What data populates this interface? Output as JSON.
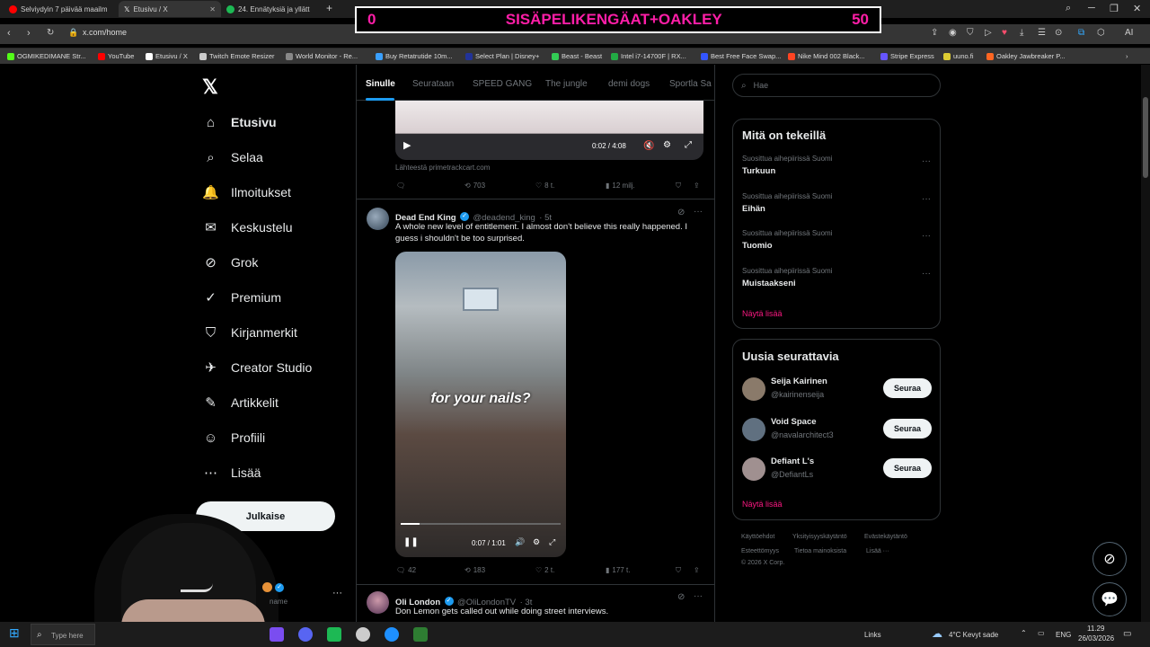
{
  "browser": {
    "tabs": [
      {
        "label": "Selviydyin 7 päivää maailm",
        "color": "#ff0000"
      },
      {
        "label": "Etusivu / X",
        "color": "#ffffff"
      },
      {
        "label": "24. Ennätyksiä ja yllätt",
        "color": "#1db954"
      }
    ],
    "new_tab": "+",
    "url": "x.com/home",
    "bookmarks": [
      {
        "label": "OGMIKEDIMANE Str...",
        "color": "#53fc18"
      },
      {
        "label": "YouTube",
        "color": "#ff0000"
      },
      {
        "label": "Etusivu / X",
        "color": "#ffffff"
      },
      {
        "label": "Twitch Emote Resizer",
        "color": "#cccccc"
      },
      {
        "label": "World Monitor - Re...",
        "color": "#888888"
      },
      {
        "label": "Buy Retatrutide 10m...",
        "color": "#3aa0ff"
      },
      {
        "label": "Select Plan | Disney+",
        "color": "#223399"
      },
      {
        "label": "Beast - Beast",
        "color": "#33cc55"
      },
      {
        "label": "Intel i7-14700F | RX...",
        "color": "#22aa44"
      },
      {
        "label": "Best Free Face Swap...",
        "color": "#3355ff"
      },
      {
        "label": "Nike Mind 002 Black...",
        "color": "#ff4422"
      },
      {
        "label": "Stripe Express",
        "color": "#6655ff"
      },
      {
        "label": "uuno.fi",
        "color": "#ddcc33"
      },
      {
        "label": "Oakley Jawbreaker P...",
        "color": "#ff6622"
      }
    ],
    "ai_label": "AI"
  },
  "overlay": {
    "left": "0",
    "title": "SISÄPELIKENGÄAT+OAKLEY",
    "right": "50"
  },
  "nav": {
    "items": [
      {
        "label": "Etusivu",
        "icon": "home-icon"
      },
      {
        "label": "Selaa",
        "icon": "search-icon"
      },
      {
        "label": "Ilmoitukset",
        "icon": "bell-icon"
      },
      {
        "label": "Keskustelu",
        "icon": "mail-icon"
      },
      {
        "label": "Grok",
        "icon": "grok-icon"
      },
      {
        "label": "Premium",
        "icon": "premium-icon"
      },
      {
        "label": "Kirjanmerkit",
        "icon": "bookmark-icon"
      },
      {
        "label": "Creator Studio",
        "icon": "rocket-icon"
      },
      {
        "label": "Artikkelit",
        "icon": "article-icon"
      },
      {
        "label": "Profiili",
        "icon": "person-icon"
      },
      {
        "label": "Lisää",
        "icon": "more-circle-icon"
      }
    ],
    "post_button": "Julkaise",
    "account_handle_fragment": "name"
  },
  "feed": {
    "tabs": [
      "Sinulle",
      "Seurataan",
      "SPEED GANG",
      "The jungle",
      "demi dogs",
      "Sportla Sa"
    ],
    "tweet1": {
      "video_time": "0:02 / 4:08",
      "source": "Lähteestä primetrackcart.com",
      "retweets": "703",
      "likes": "8 t.",
      "views": "12 milj."
    },
    "tweet2": {
      "name": "Dead End King",
      "handle": "@deadend_king",
      "time": "· 5t",
      "text_line1": "A whole new level of entitlement. I almost don't believe this really happened. I",
      "text_line2": "guess i shouldn't be too surprised.",
      "caption": "for your nails?",
      "video_time": "0:07 / 1:01",
      "replies": "42",
      "retweets": "183",
      "likes": "2 t.",
      "views": "177 t."
    },
    "tweet3": {
      "name": "Oli London",
      "handle": "@OliLondonTV",
      "time": "· 3t",
      "text": "Don Lemon gets called out while doing street interviews."
    }
  },
  "right": {
    "search_placeholder": "Hae",
    "trends_title": "Mitä on tekeillä",
    "trends": [
      {
        "category": "Suosittua aihepiirissä Suomi",
        "name": "Turkuun"
      },
      {
        "category": "Suosittua aihepiirissä Suomi",
        "name": "Eihän"
      },
      {
        "category": "Suosittua aihepiirissä Suomi",
        "name": "Tuomio"
      },
      {
        "category": "Suosittua aihepiirissä Suomi",
        "name": "Muistaakseni"
      }
    ],
    "show_more": "Näytä lisää",
    "follow_title": "Uusia seurattavia",
    "follow": [
      {
        "name": "Seija Kairinen",
        "handle": "@kairinenseija",
        "button": "Seuraa"
      },
      {
        "name": "Void Space",
        "handle": "@navalarchitect3",
        "button": "Seuraa"
      },
      {
        "name": "Defiant L's",
        "handle": "@DefiantLs",
        "button": "Seuraa"
      }
    ],
    "footer": [
      "Käyttöehdot",
      "Yksityisyyskäytäntö",
      "Evästekäytäntö",
      "Esteettömyys",
      "Tietoa mainoksista",
      "Lisää ···",
      "© 2026 X Corp."
    ]
  },
  "taskbar": {
    "search_placeholder": "Type here",
    "links": "Links",
    "weather": "4°C  Kevyt sade",
    "lang": "ENG",
    "time": "11.29",
    "date": "26/03/2026"
  }
}
